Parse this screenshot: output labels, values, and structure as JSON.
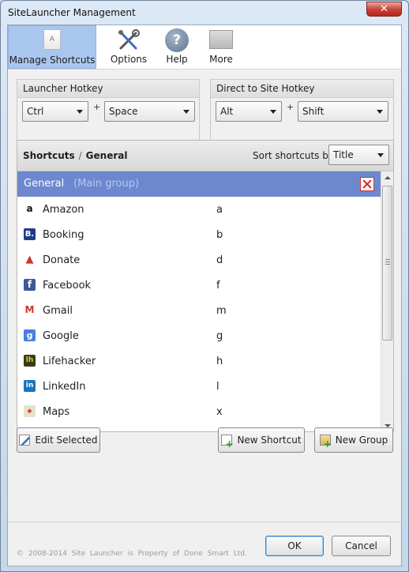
{
  "window": {
    "title": "SiteLauncher Management",
    "close_label": "✕"
  },
  "toolbar": {
    "items": [
      {
        "label": "Manage Shortcuts",
        "icon": "document-icon",
        "active": true
      },
      {
        "label": "Options",
        "icon": "tools-icon"
      },
      {
        "label": "Help",
        "icon": "help-icon"
      },
      {
        "label": "More",
        "icon": "box-icon"
      }
    ],
    "manage_icon_letter": "A",
    "help_glyph": "?"
  },
  "hotkeys": {
    "launcher": {
      "title": "Launcher Hotkey",
      "modifier": "Ctrl",
      "plus": "+",
      "key": "Space"
    },
    "direct": {
      "title": "Direct to Site Hotkey",
      "modifier": "Alt",
      "plus": "+",
      "key": "Shift"
    }
  },
  "shortcuts": {
    "breadcrumb_root": "Shortcuts",
    "breadcrumb_sep": "/",
    "breadcrumb_current": "General",
    "sort_label": "Sort shortcuts by:",
    "sort_value": "Title",
    "group": {
      "name": "General",
      "note": "(Main group)"
    },
    "rows": [
      {
        "name": "Amazon",
        "key": "a",
        "icon": "amazon-icon",
        "glyph": "a",
        "color": "#ffffff"
      },
      {
        "name": "Booking",
        "key": "b",
        "icon": "booking-icon",
        "glyph": "B.",
        "color": "#1f3c88"
      },
      {
        "name": "Donate",
        "key": "d",
        "icon": "donate-icon",
        "glyph": "▲",
        "color": "#ffffff"
      },
      {
        "name": "Facebook",
        "key": "f",
        "icon": "facebook-icon",
        "glyph": "f",
        "color": "#3b5998"
      },
      {
        "name": "Gmail",
        "key": "m",
        "icon": "gmail-icon",
        "glyph": "M",
        "color": "#ffffff"
      },
      {
        "name": "Google",
        "key": "g",
        "icon": "google-icon",
        "glyph": "g",
        "color": "#4a7fdd"
      },
      {
        "name": "Lifehacker",
        "key": "h",
        "icon": "lifehacker-icon",
        "glyph": "lh",
        "color": "#3a3a1a"
      },
      {
        "name": "LinkedIn",
        "key": "l",
        "icon": "linkedin-icon",
        "glyph": "in",
        "color": "#1b75bb"
      },
      {
        "name": "Maps",
        "key": "x",
        "icon": "maps-icon",
        "glyph": "⌖",
        "color": "#e8e2c8"
      }
    ]
  },
  "buttons": {
    "edit_selected": "Edit Selected",
    "new_shortcut": "New Shortcut",
    "new_group": "New Group",
    "ok": "OK",
    "cancel": "Cancel"
  },
  "footer": {
    "copyright": "© 2008-2014 Site Launcher is Property of Done Smart Ltd."
  }
}
